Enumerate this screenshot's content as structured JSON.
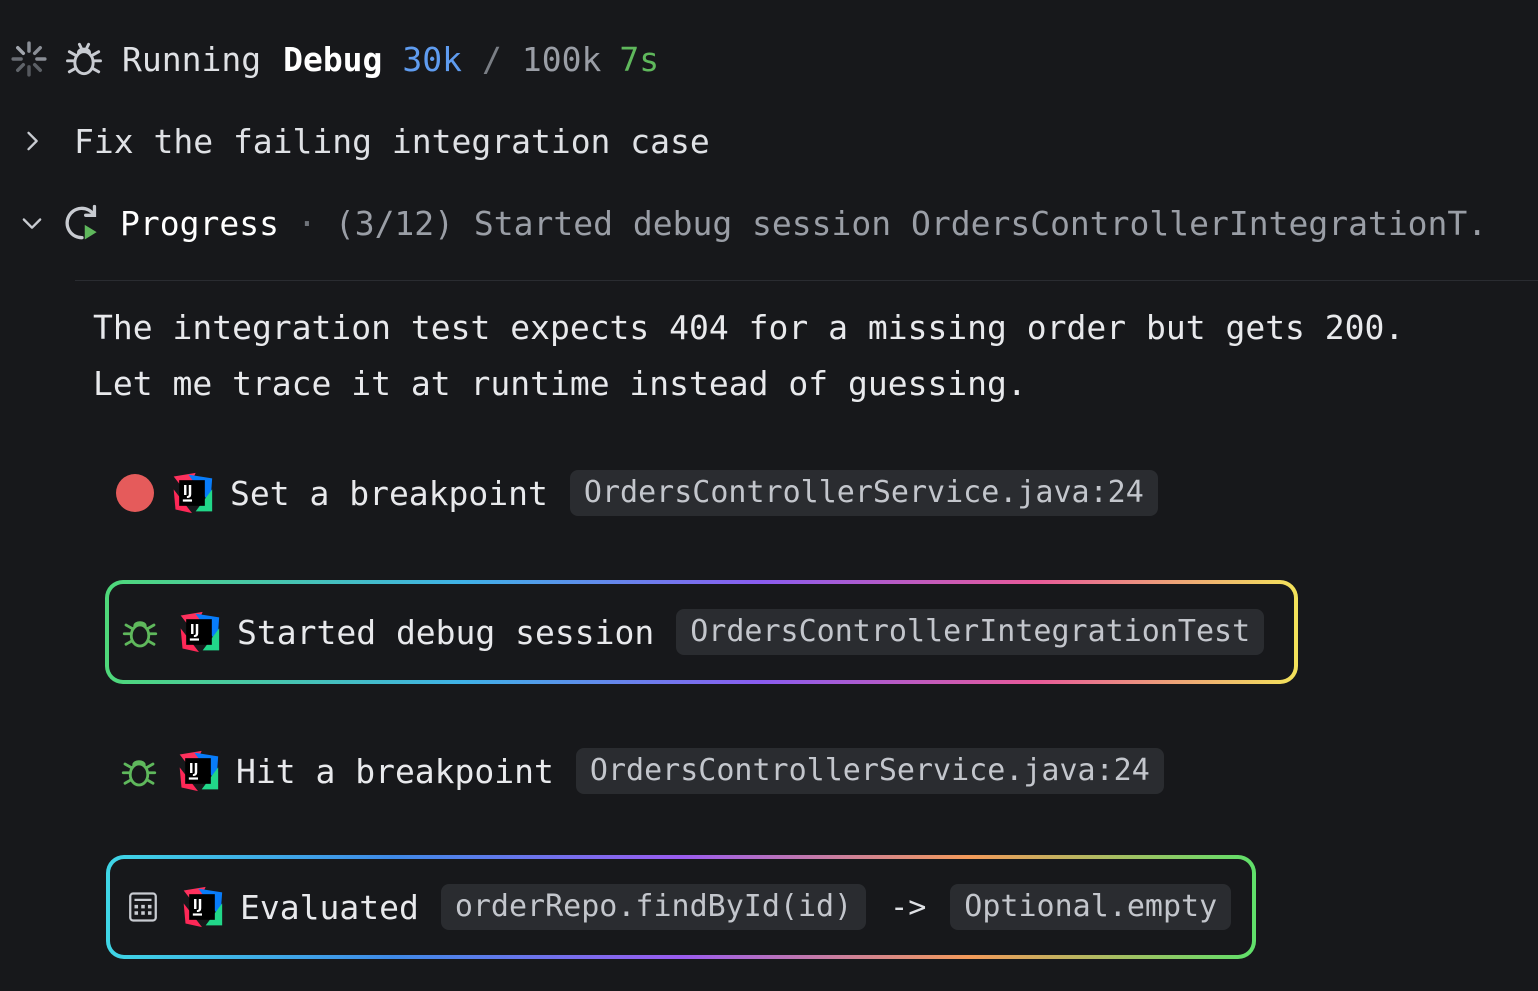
{
  "header": {
    "status": "Running",
    "mode": "Debug",
    "tokens_used": "30k",
    "separator": "/",
    "tokens_max": "100k",
    "elapsed": "7s"
  },
  "task": {
    "title": "Fix the failing integration case"
  },
  "progress": {
    "label": "Progress",
    "dot": "·",
    "detail": "(3/12) Started debug session OrdersControllerIntegrationT."
  },
  "message": {
    "line1": "The integration test expects 404 for a missing order but gets 200.",
    "line2": "Let me trace it at runtime instead of guessing."
  },
  "steps": [
    {
      "label": "Set a breakpoint",
      "chip": "OrdersControllerService.java:24",
      "icon": "breakpoint-icon"
    },
    {
      "label": "Started debug session",
      "chip": "OrdersControllerIntegrationTest",
      "icon": "bug-icon"
    },
    {
      "label": "Hit a breakpoint",
      "chip": "OrdersControllerService.java:24",
      "icon": "bug-icon"
    },
    {
      "label": "Evaluated",
      "chip": "orderRepo.findById(id)",
      "arrow": "->",
      "result": "Optional.empty",
      "icon": "calculator-icon"
    }
  ],
  "colors": {
    "background": "#17181b",
    "tokens": "#5f9cf0",
    "elapsed": "#5fb85c",
    "breakpoint": "#e55b5b",
    "chip_bg": "#2a2c30"
  }
}
